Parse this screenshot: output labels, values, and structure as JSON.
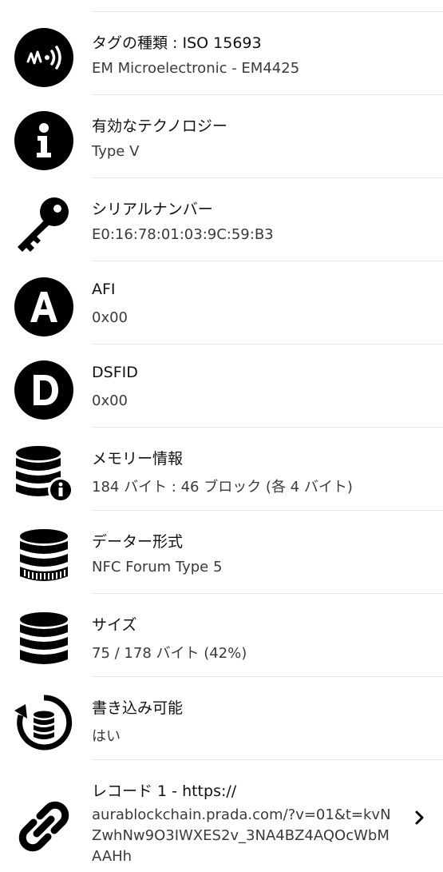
{
  "rows": [
    {
      "name": "tag-type",
      "icon": "nfc-tag-icon",
      "title": "タグの種類 : ISO 15693",
      "value": "EM Microelectronic - EM4425"
    },
    {
      "name": "technology",
      "icon": "info-icon",
      "title": "有効なテクノロジー",
      "value": "Type V"
    },
    {
      "name": "serial",
      "icon": "key-icon",
      "title": "シリアルナンバー",
      "value": "E0:16:78:01:03:9C:59:B3"
    },
    {
      "name": "afi",
      "icon": "letter-a-icon",
      "title": "AFI",
      "value": "0x00"
    },
    {
      "name": "dsfid",
      "icon": "letter-d-icon",
      "title": "DSFID",
      "value": "0x00"
    },
    {
      "name": "memory",
      "icon": "database-info-icon",
      "title": "メモリー情報",
      "value": "184 バイト : 46 ブロック (各 4 バイト)"
    },
    {
      "name": "data-format",
      "icon": "database-format-icon",
      "title": "データー形式",
      "value": "NFC Forum Type 5"
    },
    {
      "name": "size",
      "icon": "database-icon",
      "title": "サイズ",
      "value": "75 / 178 バイト (42%)"
    },
    {
      "name": "writable",
      "icon": "database-rotate-icon",
      "title": "書き込み可能",
      "value": "はい"
    },
    {
      "name": "record-1",
      "icon": "link-icon",
      "title": "レコード 1 - https://",
      "value": "aurablockchain.prada.com/?v=01&t=kvNZwhNw9O3IWXES2v_3NA4BZ4AQOcWbMAAHh"
    }
  ]
}
